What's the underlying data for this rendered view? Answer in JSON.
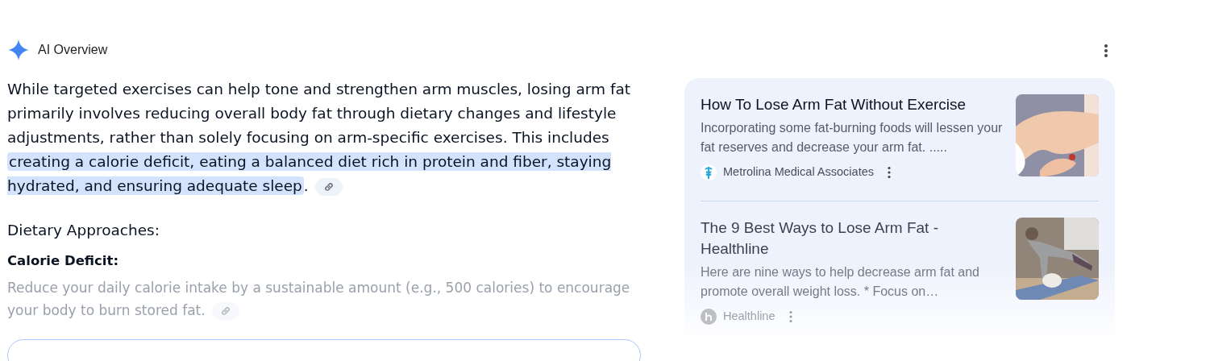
{
  "header": {
    "title": "AI Overview"
  },
  "summary": {
    "segments": [
      {
        "text": "While targeted exercises can help tone and strengthen arm muscles, losing arm fat primarily involves reducing overall body fat through dietary changes and lifestyle adjustments, rather than solely focusing on arm-specific exercises. This includes ",
        "highlighted": false
      },
      {
        "text": "creating a calorie deficit, eating a balanced diet rich in protein and fiber, staying hydrated, and ensuring adequate sleep",
        "highlighted": true
      },
      {
        "text": ".",
        "highlighted": false
      }
    ]
  },
  "sections": [
    {
      "heading": "Dietary Approaches:",
      "items": [
        {
          "title": "Calorie Deficit:",
          "text": "Reduce your daily calorie intake by a sustainable amount (e.g., 500 calories) to encourage your body to burn stored fat."
        }
      ]
    }
  ],
  "sources": [
    {
      "title": "How To Lose Arm Fat Without Exercise",
      "snippet": "Incorporating some fat-burning foods will lessen your fat reserves and decrease your arm fat. .....",
      "site": "Metrolina Medical Associates",
      "kind": "arm"
    },
    {
      "title": "The 9 Best Ways to Lose Arm Fat - Healthline",
      "snippet": "Here are nine ways to help decrease arm fat and promote overall weight loss. * Focus on…",
      "site": "Healthline",
      "kind": "exercise"
    }
  ]
}
